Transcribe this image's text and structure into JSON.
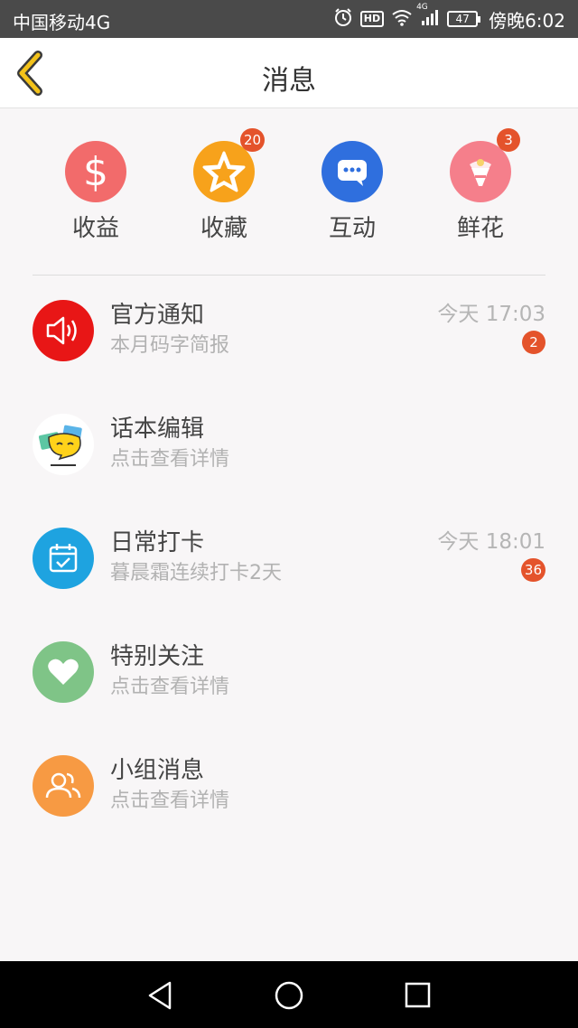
{
  "status_bar": {
    "carrier": "中国移动4G",
    "hd": "HD",
    "network": "4G",
    "battery": "47",
    "time": "傍晚6:02"
  },
  "header": {
    "title": "消息",
    "back_icon": "chevron-left-icon"
  },
  "quick_actions": [
    {
      "label": "收益",
      "icon": "dollar-icon",
      "color": "#f26b6b",
      "badge": ""
    },
    {
      "label": "收藏",
      "icon": "star-icon",
      "color": "#f7a21b",
      "badge": "20"
    },
    {
      "label": "互动",
      "icon": "chat-bubble-icon",
      "color": "#2f6fde",
      "badge": ""
    },
    {
      "label": "鲜花",
      "icon": "flower-bouquet-icon",
      "color": "#f57f8b",
      "badge": "3"
    }
  ],
  "messages": [
    {
      "title": "官方通知",
      "subtitle": "本月码字简报",
      "time": "今天 17:03",
      "badge": "2",
      "icon": "speaker-icon",
      "color": "#e81616"
    },
    {
      "title": "话本编辑",
      "subtitle": "点击查看详情",
      "time": "",
      "badge": "",
      "icon": "editor-avatar-icon",
      "color": "#ffffff"
    },
    {
      "title": "日常打卡",
      "subtitle": "暮晨霜连续打卡2天",
      "time": "今天 18:01",
      "badge": "36",
      "icon": "calendar-check-icon",
      "color": "#1ea3e0"
    },
    {
      "title": "特别关注",
      "subtitle": "点击查看详情",
      "time": "",
      "badge": "",
      "icon": "heart-icon",
      "color": "#7fc487"
    },
    {
      "title": "小组消息",
      "subtitle": "点击查看详情",
      "time": "",
      "badge": "",
      "icon": "group-icon",
      "color": "#f79a43"
    }
  ],
  "nav": {
    "back": "triangle-back-icon",
    "home": "circle-home-icon",
    "recent": "square-recent-icon"
  }
}
